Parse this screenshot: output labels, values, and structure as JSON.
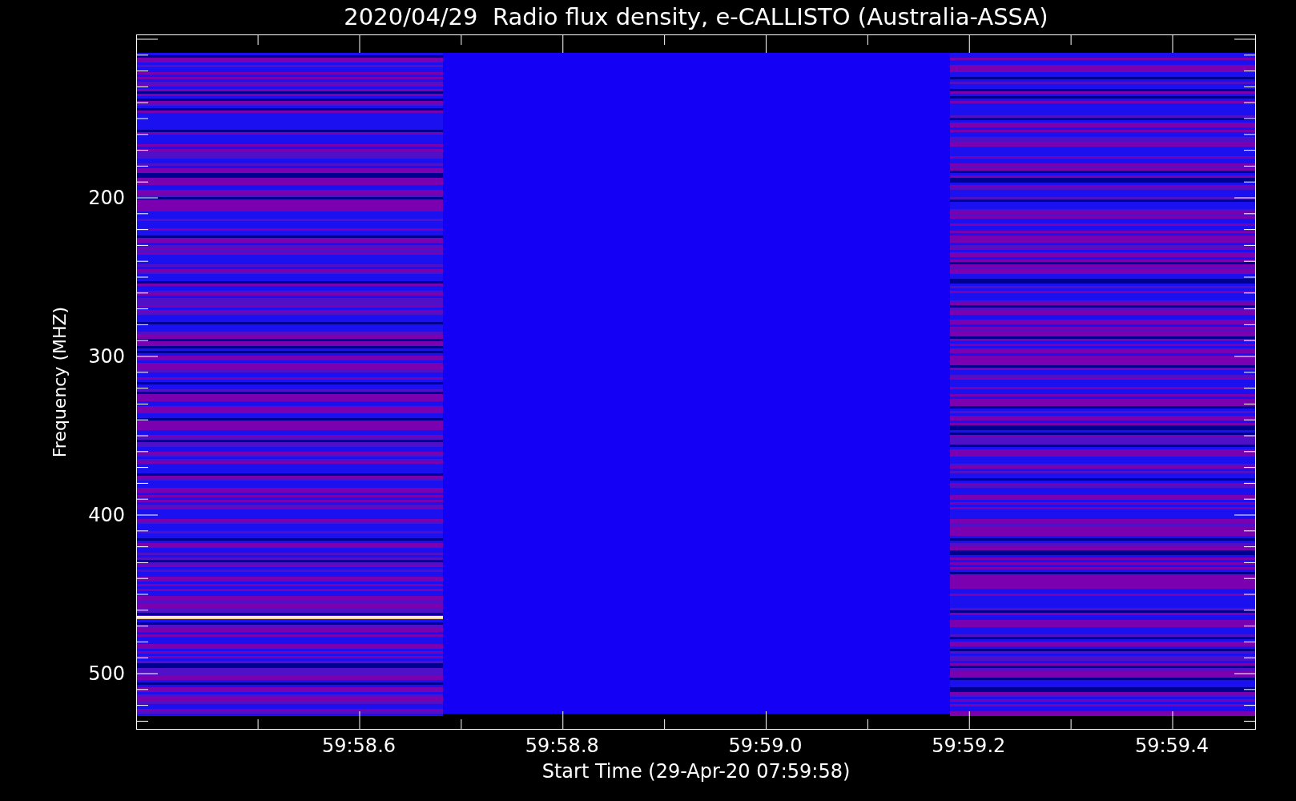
{
  "chart": {
    "title": "2020/04/29  Radio flux density, e-CALLISTO (Australia-ASSA)",
    "ylabel": "Frequency (MHZ)",
    "yticks": [
      "200",
      "300",
      "400",
      "500"
    ],
    "xlabel": "Start Time (29-Apr-20 07:59:58)",
    "xticks": [
      "59:58.6",
      "59:58.8",
      "59:59.0",
      "59:59.2",
      "59:59.4"
    ]
  }
}
